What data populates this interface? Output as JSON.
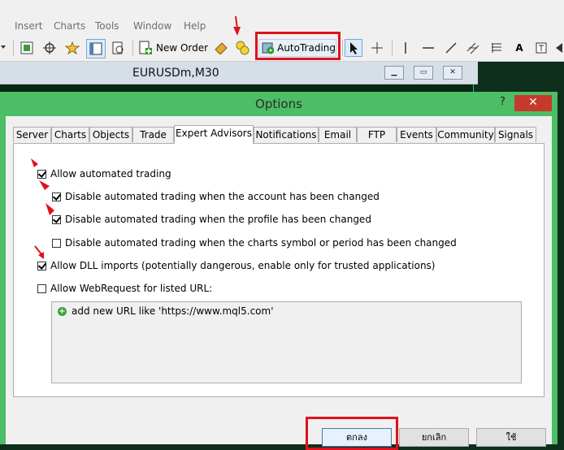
{
  "menu": [
    "Insert",
    "Charts",
    "Tools",
    "Window",
    "Help"
  ],
  "toolbar": {
    "new_order_label": "New Order",
    "autotrading_label": "AutoTrading"
  },
  "chart": {
    "title": "EURUSDm,M30"
  },
  "dialog": {
    "title": "Options",
    "help": "?",
    "close": "✕",
    "tabs": [
      "Server",
      "Charts",
      "Objects",
      "Trade",
      "Expert Advisors",
      "Notifications",
      "Email",
      "FTP",
      "Events",
      "Community",
      "Signals"
    ],
    "active_tab": "Expert Advisors",
    "options": {
      "allow_automated": "Allow automated trading",
      "disable_account": "Disable automated trading when the account has been changed",
      "disable_profile": "Disable automated trading when the profile has been changed",
      "disable_symbol": "Disable automated trading when the charts symbol or period has been changed",
      "allow_dll": "Allow DLL imports (potentially dangerous, enable only for trusted applications)",
      "allow_webrequest": "Allow WebRequest for listed URL:"
    },
    "url_list": {
      "add_label": "add new URL like 'https://www.mql5.com'"
    },
    "buttons": {
      "ok": "ตกลง",
      "cancel": "ยกเลิก",
      "apply": "ใช้"
    }
  },
  "colors": {
    "highlight_red": "#e0111b",
    "dialog_frame": "#4dbd66",
    "close_button": "#c7392d"
  }
}
